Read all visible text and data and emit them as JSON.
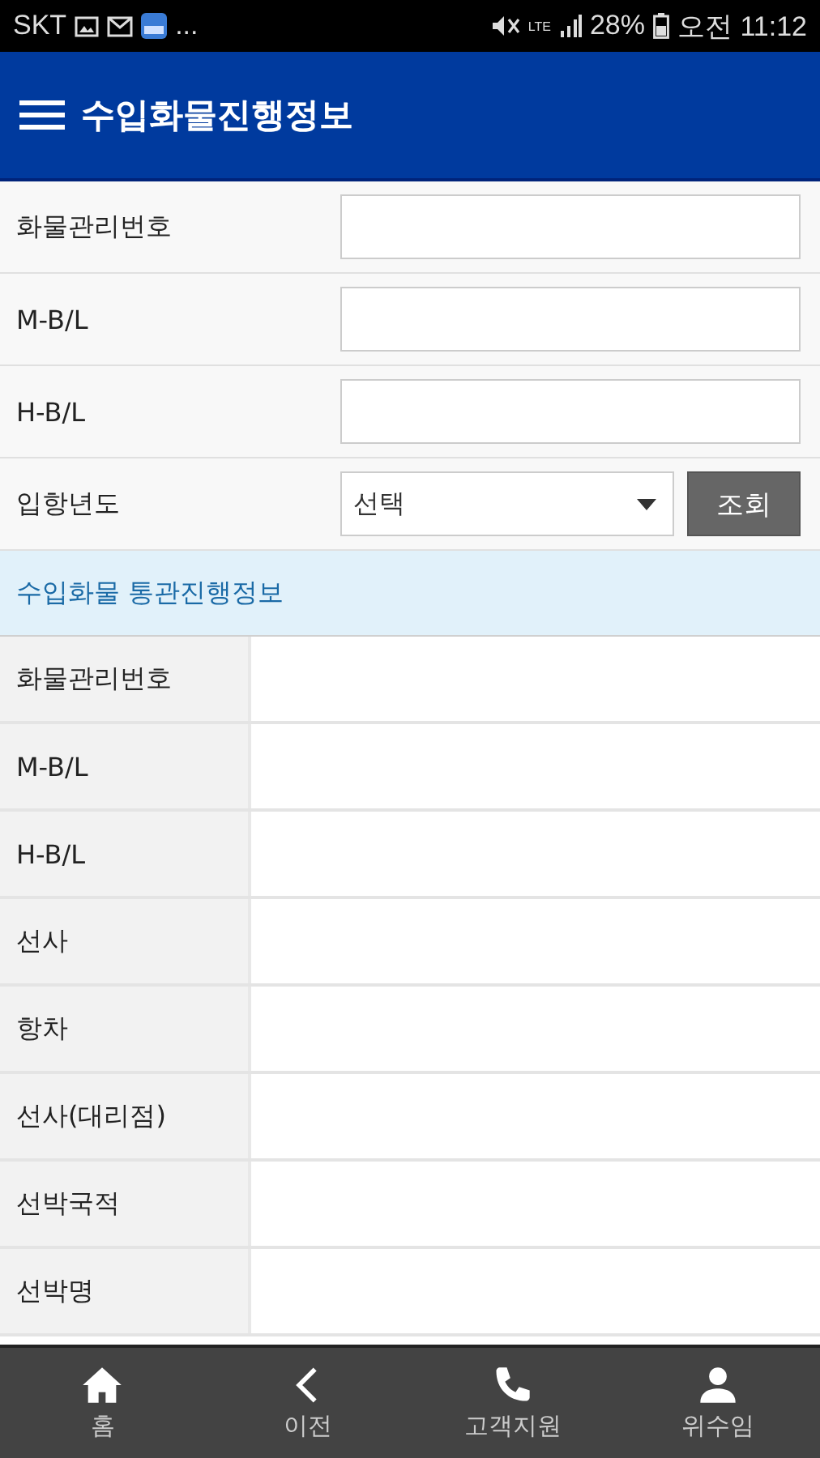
{
  "status_bar": {
    "carrier": "SKT",
    "more": "...",
    "network": "LTE",
    "battery": "28%",
    "time": "오전 11:12"
  },
  "header": {
    "title": "수입화물진행정보"
  },
  "search_form": {
    "fields": [
      {
        "kind": "text",
        "label": "화물관리번호"
      },
      {
        "kind": "text",
        "label": "M-B/L"
      },
      {
        "kind": "text",
        "label": "H-B/L"
      },
      {
        "kind": "select",
        "label": "입항년도",
        "value": "선택",
        "button": "조회"
      }
    ]
  },
  "section_title": "수입화물 통관진행정보",
  "info_table": {
    "rows": [
      {
        "label": "화물관리번호"
      },
      {
        "label": "M-B/L"
      },
      {
        "label": "H-B/L"
      },
      {
        "label": "선사"
      },
      {
        "label": "항차"
      },
      {
        "label": "선사(대리점)"
      },
      {
        "label": "선박국적"
      },
      {
        "label": "선박명"
      }
    ]
  },
  "bottom_nav": [
    {
      "label": "홈"
    },
    {
      "label": "이전"
    },
    {
      "label": "고객지원"
    },
    {
      "label": "위수임"
    }
  ]
}
